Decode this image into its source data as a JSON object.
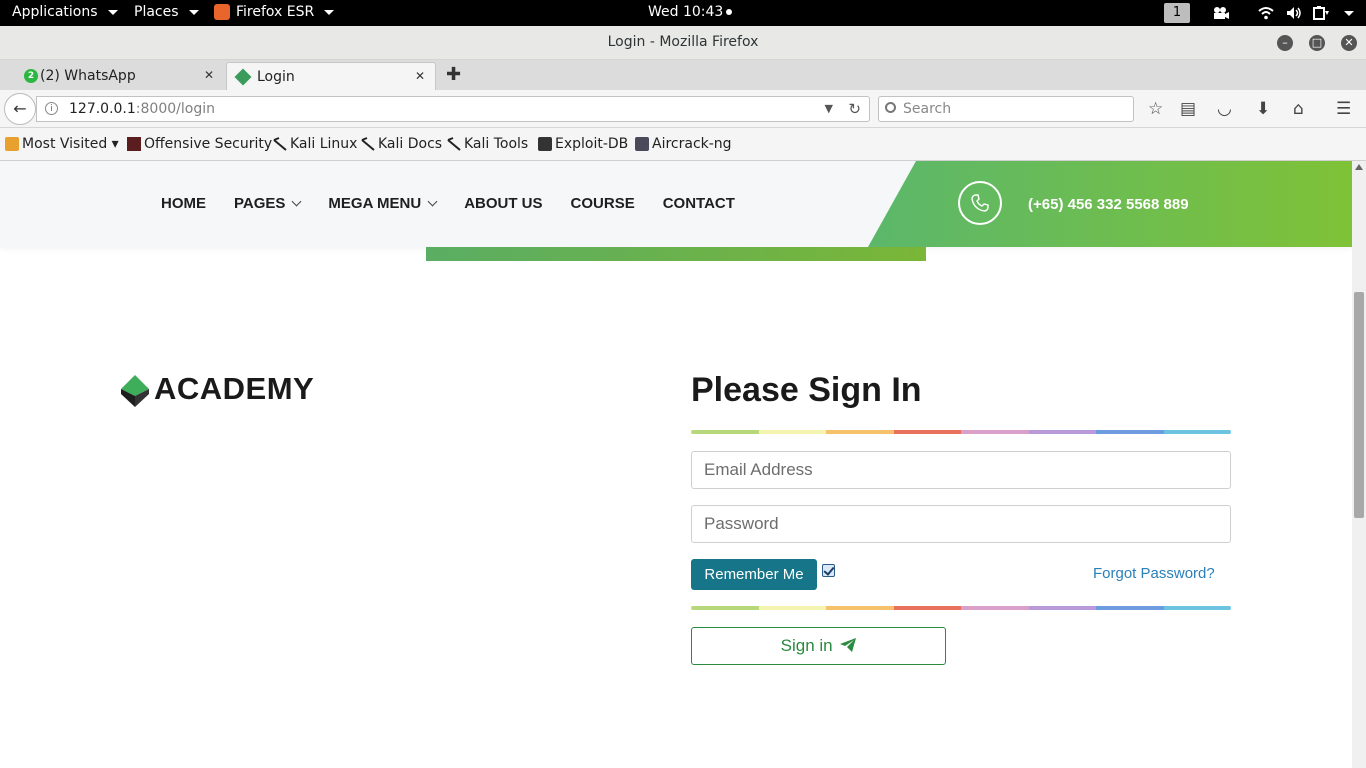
{
  "topbar": {
    "applications": "Applications",
    "places": "Places",
    "firefox_app": "Firefox ESR",
    "clock": "Wed 10:43",
    "workspace": "1"
  },
  "window": {
    "title": "Login - Mozilla Firefox"
  },
  "tabs": [
    {
      "label": "(2) WhatsApp",
      "badge": "2"
    },
    {
      "label": "Login"
    }
  ],
  "url": {
    "host": "127.0.0.1",
    "path": ":8000/login",
    "search_placeholder": "Search"
  },
  "bookmarks": [
    {
      "label": "Most Visited ▾",
      "icon": "most-visited-icon"
    },
    {
      "label": "Offensive Security",
      "icon": "offsec-icon"
    },
    {
      "label": "Kali Linux",
      "icon": "kali-dragon-icon"
    },
    {
      "label": "Kali Docs",
      "icon": "kali-dragon-icon"
    },
    {
      "label": "Kali Tools",
      "icon": "kali-dragon-icon"
    },
    {
      "label": "Exploit-DB",
      "icon": "exploitdb-icon"
    },
    {
      "label": "Aircrack-ng",
      "icon": "aircrack-icon"
    }
  ],
  "site": {
    "menu": [
      "HOME",
      "PAGES",
      "MEGA MENU",
      "ABOUT US",
      "COURSE",
      "CONTACT"
    ],
    "phone": "(+65) 456 332 5568 889",
    "logo_text": "ACADEMY",
    "signin_title": "Please Sign In",
    "email_placeholder": "Email Address",
    "password_placeholder": "Password",
    "remember_label": "Remember Me",
    "remember_checked": true,
    "forgot_label": "Forgot Password?",
    "signin_button": "Sign in"
  },
  "colors": {
    "brand_green": "#7fc237",
    "teal_button": "#167588",
    "link_blue": "#2a7fb8",
    "rainbow": [
      "#b6d77a",
      "#f4f3b0",
      "#f5c26b",
      "#e8705c",
      "#d8a0c8",
      "#b89ad8",
      "#6f9ce0",
      "#6cc4e0"
    ]
  }
}
